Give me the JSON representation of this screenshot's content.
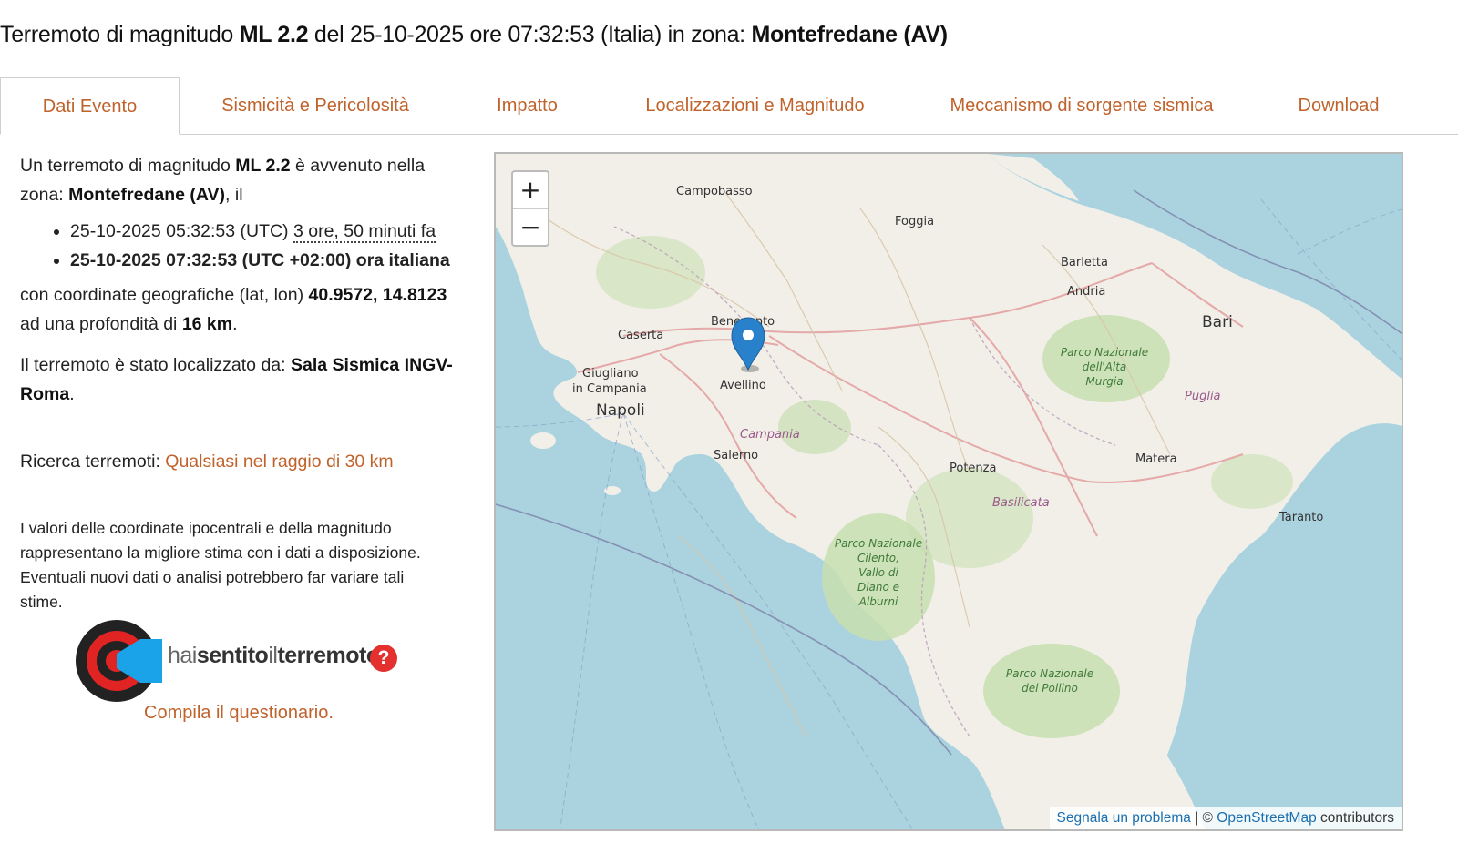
{
  "title": {
    "prefix": "Terremoto di magnitudo ",
    "magnitude": "ML 2.2",
    "middle": " del 25-10-2025 ore 07:32:53 (Italia) in zona: ",
    "zone": "Montefredane (AV)"
  },
  "tabs": [
    {
      "label": "Dati Evento",
      "active": true
    },
    {
      "label": "Sismicità e Pericolosità",
      "active": false
    },
    {
      "label": "Impatto",
      "active": false
    },
    {
      "label": "Localizzazioni e Magnitudo",
      "active": false
    },
    {
      "label": "Meccanismo di sorgente sismica",
      "active": false
    },
    {
      "label": "Download",
      "active": false
    }
  ],
  "event": {
    "intro_1": "Un terremoto di magnitudo ",
    "magnitude": "ML 2.2",
    "intro_2": " è avvenuto nella zona: ",
    "zone": "Montefredane (AV)",
    "intro_3": ", il",
    "utc_time": "25-10-2025 05:32:53 (UTC)",
    "ago": "3 ore, 50 minuti fa",
    "local_time": "25-10-2025 07:32:53 (UTC +02:00) ora italiana",
    "coords_prefix": "con coordinate geografiche (lat, lon) ",
    "coords": "40.9572, 14.8123",
    "depth_prefix": "ad una profondità di ",
    "depth": "16 km",
    "depth_suffix": ".",
    "located_prefix": "Il terremoto è stato localizzato da: ",
    "located_by": "Sala Sismica INGV-Roma",
    "located_suffix": ".",
    "search_label": "Ricerca terremoti: ",
    "search_link": "Qualsiasi nel raggio di 30 km",
    "disclaimer": "I valori delle coordinate ipocentrali e della magnitudo rappresentano la migliore stima con i dati a disposizione. Eventuali nuovi dati o analisi potrebbero far variare tali stime."
  },
  "hsit": {
    "part1": "hai",
    "part2": "sentito",
    "part3": "il",
    "part4": "terremoto",
    "qmark": "?",
    "cta": "Compila il questionario."
  },
  "map": {
    "zoom_in": "+",
    "zoom_out": "−",
    "labels": {
      "campobasso": "Campobasso",
      "foggia": "Foggia",
      "barletta": "Barletta",
      "andria": "Andria",
      "bari": "Bari",
      "benevento": "Benevento",
      "caserta": "Caserta",
      "giugliano": "Giugliano",
      "in_campania": "in Campania",
      "napoli": "Napoli",
      "avellino": "Avellino",
      "campania": "Campania",
      "salerno": "Salerno",
      "potenza": "Potenza",
      "matera": "Matera",
      "basilicata": "Basilicata",
      "puglia": "Puglia",
      "taranto": "Taranto",
      "alta_murgia_1": "Parco Nazionale",
      "alta_murgia_2": "dell'Alta",
      "alta_murgia_3": "Murgia",
      "cilento_1": "Parco Nazionale",
      "cilento_2": "Cilento,",
      "cilento_3": "Vallo di",
      "cilento_4": "Diano e",
      "cilento_5": "Alburni",
      "pollino_1": "Parco Nazionale",
      "pollino_2": "del Pollino"
    },
    "attribution_link1": "Segnala un problema",
    "attribution_sep": " | © ",
    "attribution_link2": "OpenStreetMap",
    "attribution_suffix": " contributors",
    "colors": {
      "sea": "#aad3df",
      "land": "#f2efe9",
      "park": "#c8dfb0",
      "marker": "#2a81cb"
    }
  }
}
